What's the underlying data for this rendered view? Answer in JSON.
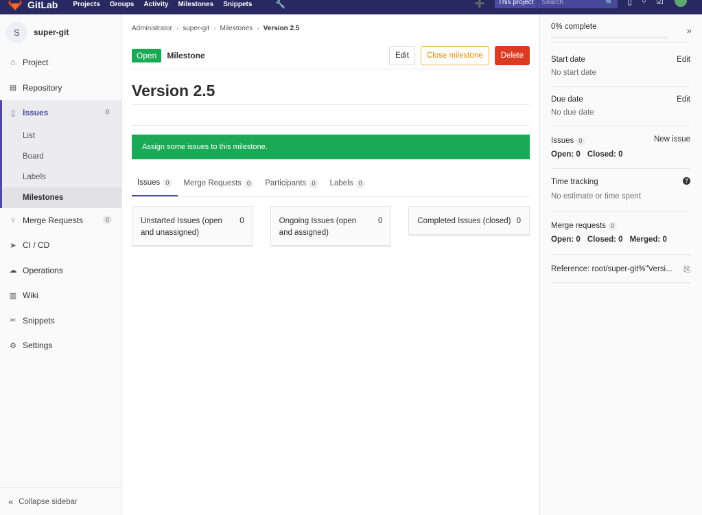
{
  "topnav": {
    "brand": "GitLab",
    "links": [
      "Projects",
      "Groups",
      "Activity",
      "Milestones",
      "Snippets"
    ],
    "scope": "This project",
    "search_placeholder": "Search"
  },
  "sidebar": {
    "project_initial": "S",
    "project_name": "super-git",
    "items": [
      {
        "label": "Project",
        "icon": "home-icon"
      },
      {
        "label": "Repository",
        "icon": "doc-icon"
      },
      {
        "label": "Issues",
        "icon": "issues-icon",
        "badge": "0"
      },
      {
        "label": "Merge Requests",
        "icon": "merge-request-icon",
        "badge": "0"
      },
      {
        "label": "CI / CD",
        "icon": "rocket-icon"
      },
      {
        "label": "Operations",
        "icon": "cloud-icon"
      },
      {
        "label": "Wiki",
        "icon": "book-icon"
      },
      {
        "label": "Snippets",
        "icon": "scissors-icon"
      },
      {
        "label": "Settings",
        "icon": "gear-icon"
      }
    ],
    "issues_sub": [
      "List",
      "Board",
      "Labels",
      "Milestones"
    ],
    "collapse_label": "Collapse sidebar"
  },
  "breadcrumb": [
    "Administrator",
    "super-git",
    "Milestones",
    "Version 2.5"
  ],
  "milestone": {
    "status": "Open",
    "label": "Milestone",
    "buttons": {
      "edit": "Edit",
      "close": "Close milestone",
      "delete": "Delete"
    },
    "title": "Version 2.5",
    "alert": "Assign some issues to this milestone."
  },
  "tabs": [
    {
      "label": "Issues",
      "count": "0"
    },
    {
      "label": "Merge Requests",
      "count": "0"
    },
    {
      "label": "Participants",
      "count": "0"
    },
    {
      "label": "Labels",
      "count": "0"
    }
  ],
  "boards": [
    {
      "title": "Unstarted Issues (open and unassigned)",
      "count": "0"
    },
    {
      "title": "Ongoing Issues (open and assigned)",
      "count": "0"
    },
    {
      "title": "Completed Issues (closed)",
      "count": "0"
    }
  ],
  "right": {
    "progress_text": "0% complete",
    "progress": 0,
    "start_date": {
      "title": "Start date",
      "value": "No start date",
      "edit": "Edit"
    },
    "due_date": {
      "title": "Due date",
      "value": "No due date",
      "edit": "Edit"
    },
    "issues": {
      "title": "Issues",
      "count": "0",
      "new": "New issue",
      "open": "Open: 0",
      "closed": "Closed: 0"
    },
    "time_tracking": {
      "title": "Time tracking",
      "value": "No estimate or time spent"
    },
    "merge_requests": {
      "title": "Merge requests",
      "count": "0",
      "open": "Open: 0",
      "closed": "Closed: 0",
      "merged": "Merged: 0"
    },
    "reference": "Reference: root/super-git%\"Versi..."
  }
}
